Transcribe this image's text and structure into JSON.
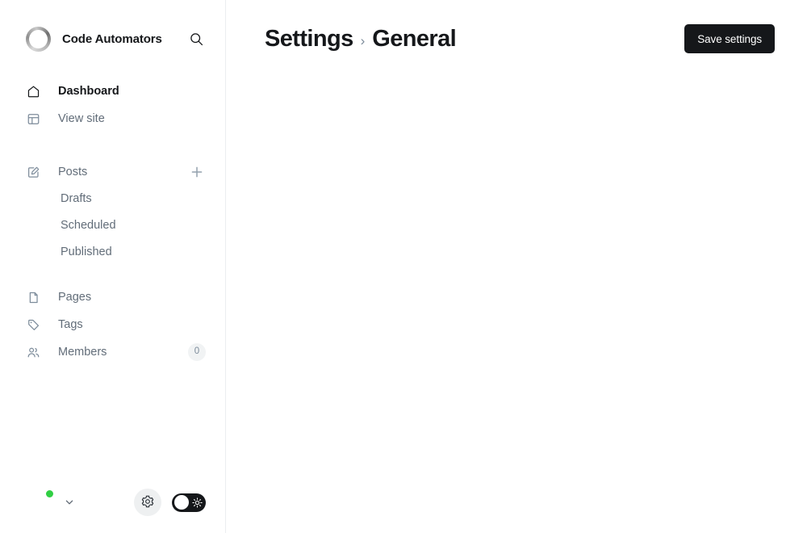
{
  "sidebar": {
    "brand": {
      "logo_icon": "ring-logo-icon",
      "title": "Code Automators",
      "search_icon": "search-icon"
    },
    "primary_nav": [
      {
        "label": "Dashboard",
        "icon": "home-icon",
        "active": true
      },
      {
        "label": "View site",
        "icon": "layout-icon",
        "active": false
      }
    ],
    "posts": {
      "label": "Posts",
      "icon": "edit-square-icon",
      "action_icon": "plus-icon",
      "children": [
        {
          "label": "Drafts"
        },
        {
          "label": "Scheduled"
        },
        {
          "label": "Published"
        }
      ]
    },
    "secondary_nav": [
      {
        "label": "Pages",
        "icon": "page-icon",
        "badge": null
      },
      {
        "label": "Tags",
        "icon": "tag-icon",
        "badge": null
      },
      {
        "label": "Members",
        "icon": "users-icon",
        "badge": "0"
      }
    ],
    "bottom": {
      "avatar_name": "user-avatar",
      "status": "online",
      "chevron_icon": "chevron-down-icon",
      "settings_icon": "gear-icon",
      "theme_toggle": {
        "icon": "sun-icon",
        "state": "light"
      }
    }
  },
  "header": {
    "breadcrumb": {
      "root": "Settings",
      "separator": "›",
      "current": "General"
    },
    "save_label": "Save settings"
  },
  "colors": {
    "accent_dark": "#15171a",
    "text_muted": "#626d79",
    "icon_muted": "#7c8b9a",
    "border": "#ebeef0",
    "badge_bg": "#f1f3f4",
    "status_online": "#30cf43",
    "toggle_bg": "#15171a"
  }
}
